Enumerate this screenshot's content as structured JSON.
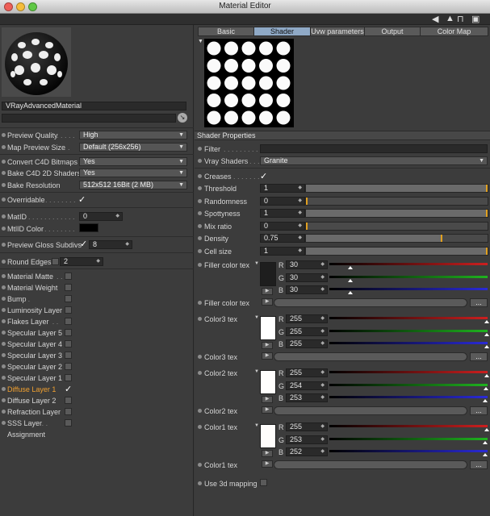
{
  "window": {
    "title": "Material Editor"
  },
  "left": {
    "material_name": "VRayAdvancedMaterial",
    "preview_quality": {
      "label": "Preview Quality",
      "value": "High"
    },
    "map_preview_size": {
      "label": "Map Preview Size",
      "value": "Default (256x256)"
    },
    "convert_c4d_bitmaps": {
      "label": "Convert C4D Bitmaps",
      "value": "Yes"
    },
    "bake_c4d_2d_shaders": {
      "label": "Bake C4D 2D Shaders",
      "value": "Yes"
    },
    "bake_resolution": {
      "label": "Bake Resolution",
      "value": "512x512   16Bit   (2 MB)"
    },
    "overridable": {
      "label": "Overridable"
    },
    "mat_id": {
      "label": "MatID",
      "value": "0"
    },
    "mtl_id_color": {
      "label": "MtlID Color",
      "color": "#000000"
    },
    "preview_gloss_subdivs": {
      "label": "Preview Gloss Subdivs",
      "value": "8"
    },
    "round_edges": {
      "label": "Round Edges",
      "value": "2"
    },
    "layers": [
      {
        "label": "Material Matte",
        "checked": false,
        "selected": false
      },
      {
        "label": "Material Weight",
        "checked": false,
        "selected": false
      },
      {
        "label": "Bump",
        "checked": false,
        "selected": false
      },
      {
        "label": "Luminosity Layer",
        "checked": false,
        "selected": false
      },
      {
        "label": "Flakes Layer",
        "checked": false,
        "selected": false
      },
      {
        "label": "Specular Layer 5",
        "checked": false,
        "selected": false
      },
      {
        "label": "Specular Layer 4",
        "checked": false,
        "selected": false
      },
      {
        "label": "Specular Layer 3",
        "checked": false,
        "selected": false
      },
      {
        "label": "Specular Layer 2",
        "checked": false,
        "selected": false
      },
      {
        "label": "Specular Layer 1",
        "checked": false,
        "selected": false
      },
      {
        "label": "Diffuse Layer 1",
        "checked": true,
        "selected": true
      },
      {
        "label": "Diffuse Layer 2",
        "checked": false,
        "selected": false
      },
      {
        "label": "Refraction Layer",
        "checked": false,
        "selected": false
      },
      {
        "label": "SSS Layer",
        "checked": false,
        "selected": false
      }
    ],
    "assignment": "Assignment"
  },
  "tabs": [
    "Basic",
    "Shader",
    "Uvw parameters",
    "Output",
    "Color Map"
  ],
  "active_tab": "Shader",
  "shader": {
    "section_title": "Shader Properties",
    "filter": {
      "label": "Filter",
      "value": ""
    },
    "vray_shaders": {
      "label": "Vray Shaders",
      "value": "Granite"
    },
    "creases": {
      "label": "Creases"
    },
    "params": [
      {
        "label": "Threshold",
        "value": "1",
        "fraction": 1.0
      },
      {
        "label": "Randomness",
        "value": "0",
        "fraction": 0.0
      },
      {
        "label": "Spottyness",
        "value": "1",
        "fraction": 1.0
      },
      {
        "label": "Mix ratio",
        "value": "0",
        "fraction": 0.0
      },
      {
        "label": "Density",
        "value": "0.75",
        "fraction": 0.75
      },
      {
        "label": "Cell size",
        "value": "1",
        "fraction": 1.0
      }
    ],
    "colors": [
      {
        "label": "Filler color tex",
        "r": "30",
        "g": "30",
        "b": "30",
        "swatch": "#1e1e1e",
        "tex_label": "Filler color tex",
        "r_frac": 0.12,
        "g_frac": 0.12,
        "b_frac": 0.12
      },
      {
        "label": "Color3 tex",
        "r": "255",
        "g": "255",
        "b": "255",
        "swatch": "#ffffff",
        "tex_label": "Color3 tex",
        "r_frac": 1.0,
        "g_frac": 1.0,
        "b_frac": 1.0
      },
      {
        "label": "Color2 tex",
        "r": "255",
        "g": "254",
        "b": "253",
        "swatch": "#fffefd",
        "tex_label": "Color2 tex",
        "r_frac": 1.0,
        "g_frac": 0.996,
        "b_frac": 0.992
      },
      {
        "label": "Color1 tex",
        "r": "255",
        "g": "253",
        "b": "252",
        "swatch": "#fffdfc",
        "tex_label": "Color1 tex",
        "r_frac": 1.0,
        "g_frac": 0.992,
        "b_frac": 0.988
      }
    ],
    "use_3d_mapping": {
      "label": "Use 3d mapping"
    },
    "rgb_labels": {
      "r": "R",
      "g": "G",
      "b": "B"
    },
    "dots_label": "..."
  }
}
